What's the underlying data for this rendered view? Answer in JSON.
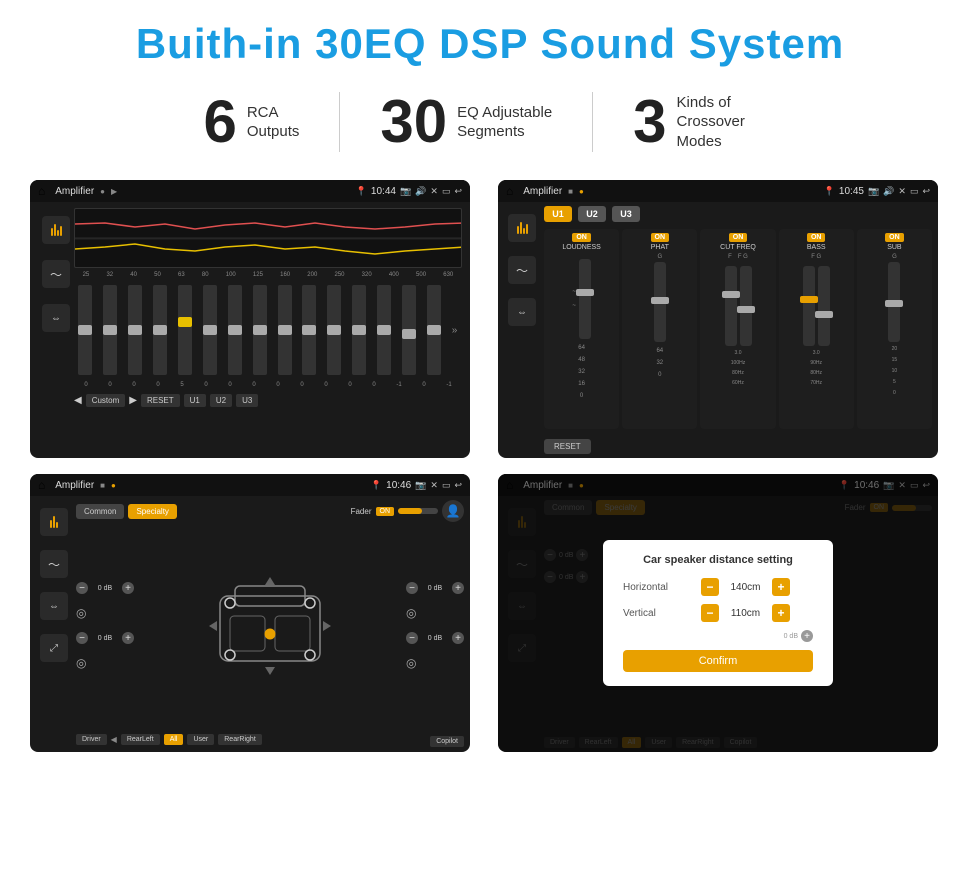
{
  "header": {
    "title": "Buith-in 30EQ DSP Sound System"
  },
  "stats": [
    {
      "number": "6",
      "label": "RCA\nOutputs"
    },
    {
      "number": "30",
      "label": "EQ Adjustable\nSegments"
    },
    {
      "number": "3",
      "label": "Kinds of\nCrossover Modes"
    }
  ],
  "screenshots": [
    {
      "id": "eq-screen",
      "status_bar": {
        "app": "Amplifier",
        "time": "10:44"
      },
      "type": "equalizer"
    },
    {
      "id": "amp-screen",
      "status_bar": {
        "app": "Amplifier",
        "time": "10:45"
      },
      "type": "amplifier-detail"
    },
    {
      "id": "crossover-screen",
      "status_bar": {
        "app": "Amplifier",
        "time": "10:46"
      },
      "type": "crossover"
    },
    {
      "id": "dialog-screen",
      "status_bar": {
        "app": "Amplifier",
        "time": "10:46"
      },
      "type": "crossover-dialog",
      "dialog": {
        "title": "Car speaker distance setting",
        "horizontal_label": "Horizontal",
        "horizontal_value": "140cm",
        "vertical_label": "Vertical",
        "vertical_value": "110cm",
        "confirm_label": "Confirm"
      }
    }
  ],
  "eq": {
    "frequencies": [
      "25",
      "32",
      "40",
      "50",
      "63",
      "80",
      "100",
      "125",
      "160",
      "200",
      "250",
      "320",
      "400",
      "500",
      "630"
    ],
    "values": [
      "0",
      "0",
      "0",
      "0",
      "5",
      "0",
      "0",
      "0",
      "0",
      "0",
      "0",
      "0",
      "0",
      "-1",
      "0",
      "-1"
    ],
    "modes": [
      "Custom",
      "RESET",
      "U1",
      "U2",
      "U3"
    ],
    "slider_positions": [
      50,
      50,
      50,
      50,
      60,
      50,
      50,
      50,
      50,
      50,
      50,
      50,
      50,
      45,
      50,
      45
    ]
  },
  "amplifier": {
    "u_buttons": [
      "U1",
      "U2",
      "U3"
    ],
    "columns": [
      {
        "label": "LOUDNESS",
        "on": true
      },
      {
        "label": "PHAT",
        "on": true
      },
      {
        "label": "CUT FREQ",
        "on": true
      },
      {
        "label": "BASS",
        "on": true
      },
      {
        "label": "SUB",
        "on": true
      }
    ],
    "reset_label": "RESET"
  },
  "crossover": {
    "tabs": [
      "Common",
      "Specialty"
    ],
    "active_tab": "Specialty",
    "fader_label": "Fader",
    "fader_on": true,
    "bottom_labels": [
      "Driver",
      "RearLeft",
      "All",
      "User",
      "RearRight",
      "Copilot"
    ],
    "db_labels": [
      "0 dB",
      "0 dB",
      "0 dB",
      "0 dB"
    ]
  },
  "dialog": {
    "title": "Car speaker distance setting",
    "horizontal_label": "Horizontal",
    "horizontal_value": "140cm",
    "vertical_label": "Vertical",
    "vertical_value": "110cm",
    "confirm_label": "Confirm"
  },
  "icons": {
    "home": "⌂",
    "back": "↩",
    "play": "▶",
    "prev": "◀",
    "expand": "»",
    "minus": "−",
    "plus": "+"
  }
}
